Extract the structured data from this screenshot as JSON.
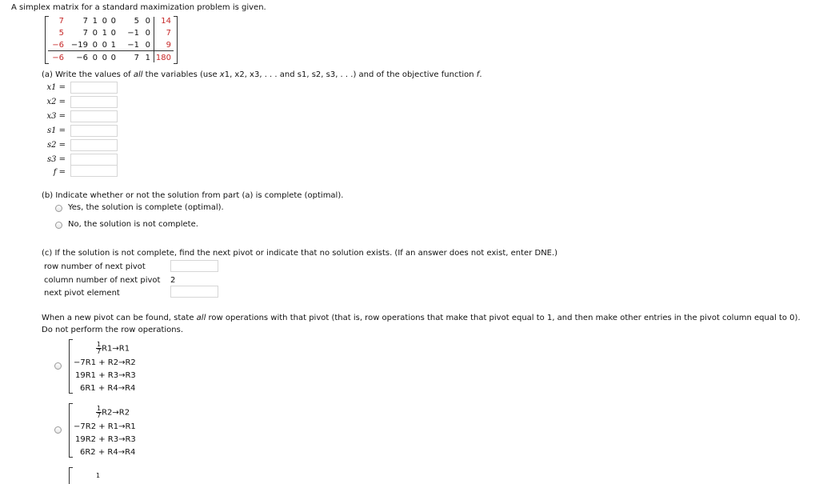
{
  "problem_intro": "A simplex matrix for a standard maximization problem is given.",
  "matrix": {
    "rows": [
      [
        "7",
        "7",
        "1",
        "0",
        "0",
        "5",
        "0",
        "14"
      ],
      [
        "5",
        "7",
        "0",
        "1",
        "0",
        "−1",
        "0",
        "7"
      ],
      [
        "−6",
        "−19",
        "0",
        "0",
        "1",
        "−1",
        "0",
        "9"
      ],
      [
        "−6",
        "−6",
        "0",
        "0",
        "0",
        "7",
        "1",
        "180"
      ]
    ],
    "red_color": "#c62828"
  },
  "part_a": {
    "prompt_1": "(a) Write the values of ",
    "prompt_all": "all",
    "prompt_2": " the variables (use ",
    "prompt_vars1": "x",
    "prompt_3": "1, x2, x3, . . . and s1, s2, s3, . . .) and of the objective function ",
    "prompt_f": "f",
    "prompt_4": ".",
    "labels": [
      "x1 =",
      "x2 =",
      "x3 =",
      "s1 =",
      "s2 =",
      "s3 =",
      "f ="
    ]
  },
  "part_b": {
    "prompt": "(b) Indicate whether or not the solution from part (a) is complete (optimal).",
    "option_yes": "Yes, the solution is complete (optimal).",
    "option_no": "No, the solution is not complete."
  },
  "part_c": {
    "prompt": "(c) If the solution is not complete, find the next pivot or indicate that no solution exists. (If an answer does not exist, enter DNE.)",
    "row_label": "row number of next pivot",
    "col_label": "column number of next pivot",
    "col_value": "2",
    "elem_label": "next pivot element"
  },
  "row_ops": {
    "prompt_1": "When a new pivot can be found, state ",
    "prompt_all": "all",
    "prompt_2": " row operations with that pivot (that is, row operations that make that pivot equal to 1, and then make other entries in the pivot column equal to 0).",
    "prompt_3": "Do not perform the row operations.",
    "choices": [
      {
        "frac_num": "1",
        "frac_den": "7",
        "line1": "R1→R1",
        "line2": "−7R1 + R2→R2",
        "line3": "19R1 + R3→R3",
        "line4": "6R1 + R4→R4"
      },
      {
        "frac_num": "1",
        "frac_den": "7",
        "line1": "R2→R2",
        "line2": "−7R2 + R1→R1",
        "line3": "19R2 + R3→R3",
        "line4": "6R2 + R4→R4"
      }
    ],
    "partial_next": "1"
  }
}
